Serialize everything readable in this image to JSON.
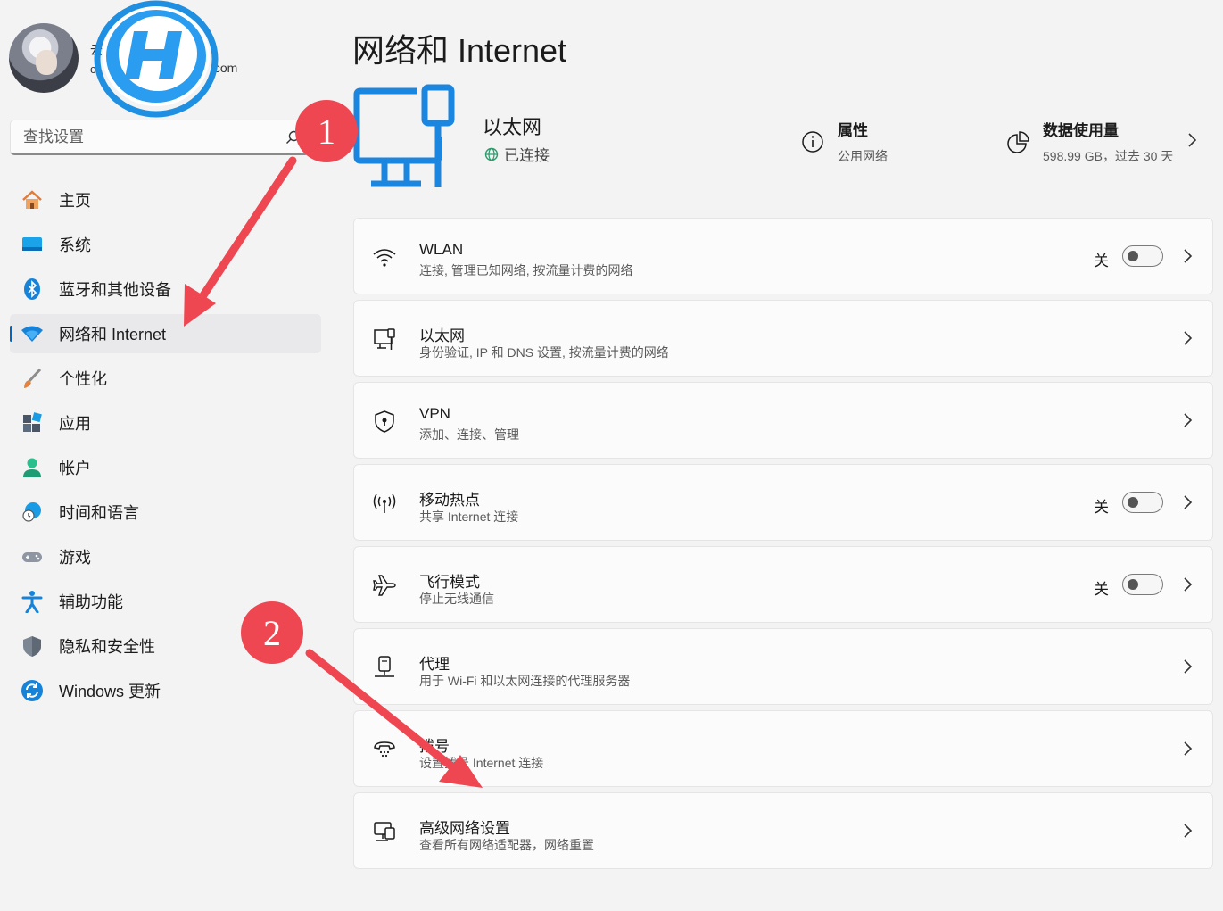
{
  "user": {
    "name_fragment": "云",
    "email_fragment": "c",
    "email_tail": ".com"
  },
  "search": {
    "placeholder": "查找设置"
  },
  "sidebar": {
    "items": [
      {
        "label": "主页",
        "icon": "home-icon"
      },
      {
        "label": "系统",
        "icon": "system-icon"
      },
      {
        "label": "蓝牙和其他设备",
        "icon": "bluetooth-icon"
      },
      {
        "label": "网络和 Internet",
        "icon": "network-icon",
        "selected": true
      },
      {
        "label": "个性化",
        "icon": "brush-icon"
      },
      {
        "label": "应用",
        "icon": "apps-icon"
      },
      {
        "label": "帐户",
        "icon": "account-icon"
      },
      {
        "label": "时间和语言",
        "icon": "time-language-icon"
      },
      {
        "label": "游戏",
        "icon": "gamepad-icon"
      },
      {
        "label": "辅助功能",
        "icon": "accessibility-icon"
      },
      {
        "label": "隐私和安全性",
        "icon": "shield-icon"
      },
      {
        "label": "Windows 更新",
        "icon": "update-icon"
      }
    ]
  },
  "main": {
    "title": "网络和 Internet",
    "connection": {
      "name": "以太网",
      "status": "已连接"
    },
    "properties": {
      "title": "属性",
      "subtitle": "公用网络"
    },
    "data_usage": {
      "title": "数据使用量",
      "subtitle": "598.99 GB，过去 30 天"
    },
    "cards": [
      {
        "title": "WLAN",
        "subtitle": "连接, 管理已知网络, 按流量计费的网络",
        "icon": "wifi-icon",
        "toggle": "关"
      },
      {
        "title": "以太网",
        "subtitle": "身份验证, IP 和 DNS 设置, 按流量计费的网络",
        "icon": "ethernet-icon"
      },
      {
        "title": "VPN",
        "subtitle": "添加、连接、管理",
        "icon": "vpn-shield-icon"
      },
      {
        "title": "移动热点",
        "subtitle": "共享 Internet 连接",
        "icon": "hotspot-icon",
        "toggle": "关"
      },
      {
        "title": "飞行模式",
        "subtitle": "停止无线通信",
        "icon": "airplane-icon",
        "toggle": "关"
      },
      {
        "title": "代理",
        "subtitle": "用于 Wi-Fi 和以太网连接的代理服务器",
        "icon": "proxy-icon"
      },
      {
        "title": "拨号",
        "subtitle": "设置拨号 Internet 连接",
        "icon": "dialup-icon"
      },
      {
        "title": "高级网络设置",
        "subtitle": "查看所有网络适配器，网络重置",
        "icon": "advanced-network-icon"
      }
    ]
  },
  "annotations": {
    "badge1": "1",
    "badge2": "2"
  },
  "colors": {
    "accent": "#0067c0",
    "badge": "#ee4752",
    "background": "#f3f3f3"
  }
}
